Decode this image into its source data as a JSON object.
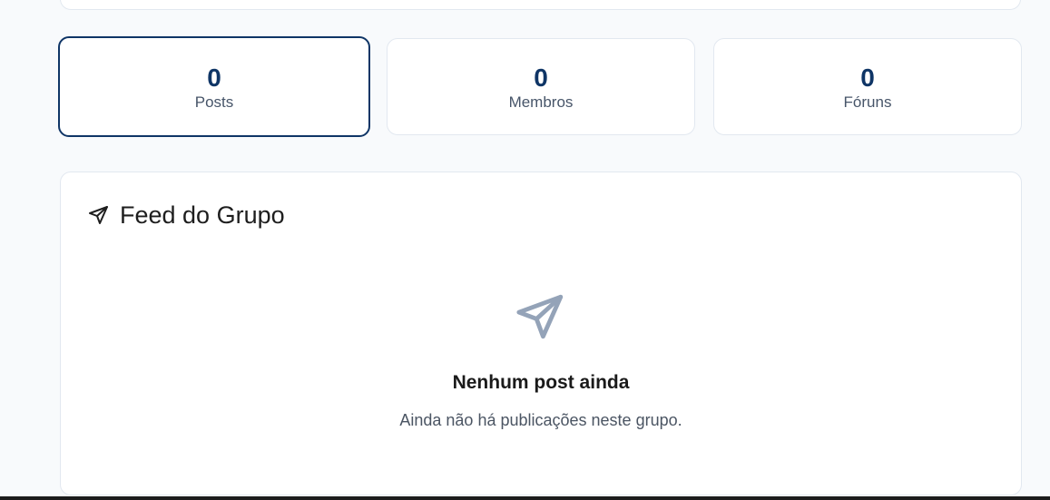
{
  "stats": [
    {
      "value": "0",
      "label": "Posts"
    },
    {
      "value": "0",
      "label": "Membros"
    },
    {
      "value": "0",
      "label": "Fóruns"
    }
  ],
  "feed": {
    "title": "Feed do Grupo",
    "title_icon": "send-icon",
    "empty_icon": "send-icon",
    "empty_title": "Nenhum post ainda",
    "empty_description": "Ainda não há publicações neste grupo."
  },
  "colors": {
    "accent": "#0f3566",
    "empty_icon": "#94a3b8"
  }
}
